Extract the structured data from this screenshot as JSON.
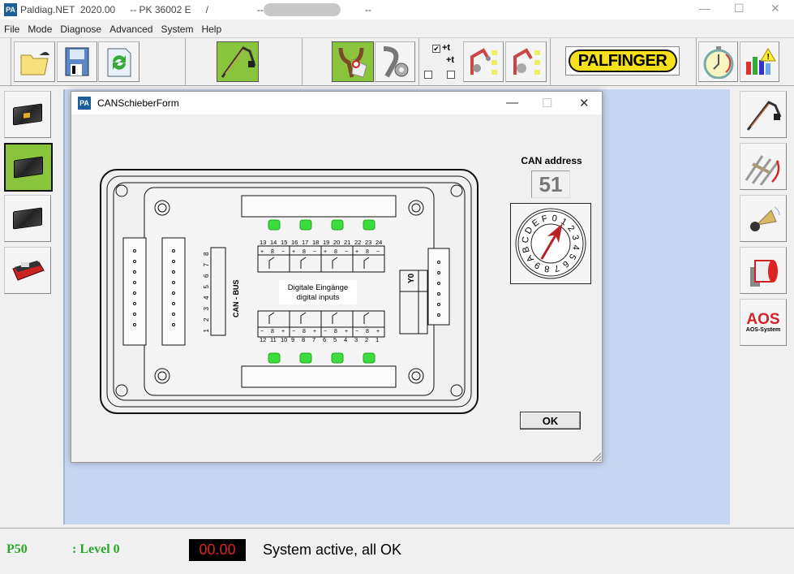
{
  "titlebar": {
    "app": "Paldiag.NET  2020.00",
    "model": "-- PK 36002 E",
    "slash": "/",
    "dash1": "--",
    "dash2": "--",
    "logo": "PA"
  },
  "menu": [
    "File",
    "Mode",
    "Diagnose",
    "Advanced",
    "System",
    "Help"
  ],
  "toolbar": {
    "checkbox_label_1": "+t",
    "checkbox_label_2": "+t",
    "checkbox_1_checked": true,
    "checkbox_2_checked": false,
    "checkbox_3_checked": false,
    "brand": "PALFINGER",
    "accent_green": "#8ac43c"
  },
  "right_sidebar": {
    "aos_label": "AOS",
    "aos_sub": "AOS-System"
  },
  "dialog": {
    "title": "CANSchieberForm",
    "logo": "PA",
    "can_address_label": "CAN address",
    "can_address_value": "51",
    "dial_chars": [
      "0",
      "1",
      "2",
      "3",
      "4",
      "5",
      "6",
      "7",
      "8",
      "9",
      "A",
      "B",
      "C",
      "D",
      "E",
      "F"
    ],
    "dial_position": "1",
    "ok_label": "OK",
    "board": {
      "center_label_1": "Digitale Eingänge",
      "center_label_2": "digital inputs",
      "can_bus_label": "CAN - BUS",
      "y0_label": "Y0",
      "top_numbers": [
        "13",
        "14",
        "15",
        "16",
        "17",
        "18",
        "19",
        "20",
        "21",
        "22",
        "23",
        "24"
      ],
      "bottom_numbers": [
        "12",
        "11",
        "10",
        "9",
        "8",
        "7",
        "6",
        "5",
        "4",
        "3",
        "2",
        "1"
      ],
      "top_polarity": [
        "+",
        "8",
        "−",
        "+",
        "8",
        "−",
        "+",
        "8",
        "−",
        "+",
        "8",
        "−"
      ],
      "bottom_polarity": [
        "−",
        "8",
        "+",
        "−",
        "8",
        "+",
        "−",
        "8",
        "+",
        "−",
        "8",
        "+"
      ],
      "can_pins": [
        "8",
        "7",
        "6",
        "5",
        "4",
        "3",
        "2",
        "1"
      ],
      "led_color": "#3ddc3d"
    }
  },
  "statusbar": {
    "program": "P50",
    "level": ": Level 0",
    "timer": "00.00",
    "message": "System active, all OK"
  }
}
